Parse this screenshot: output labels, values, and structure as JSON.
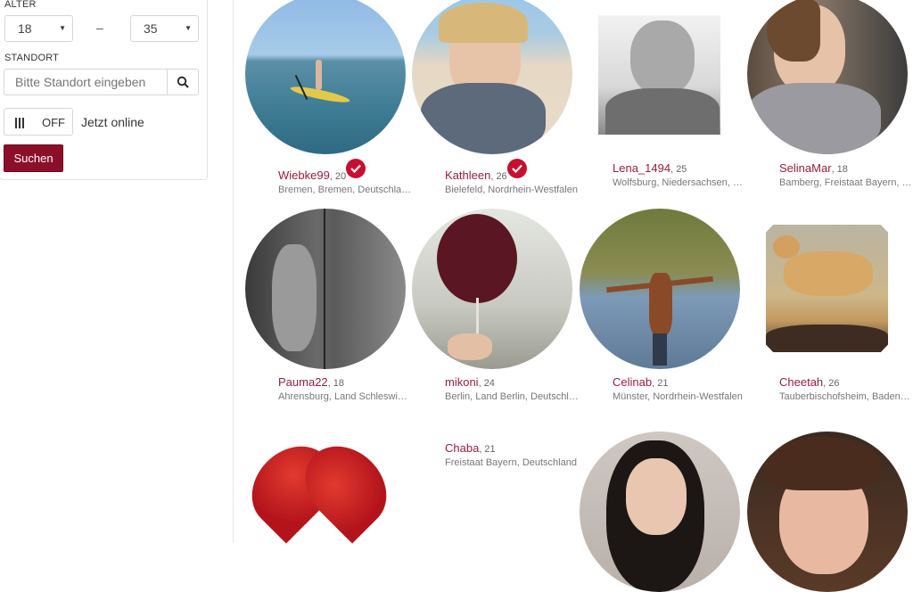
{
  "filters": {
    "age_label": "ALTER",
    "age_min": "18",
    "age_max": "35",
    "age_sep": "–",
    "location_label": "STANDORT",
    "location_placeholder": "Bitte Standort eingeben",
    "online_toggle": "OFF",
    "online_label": "Jetzt online",
    "search_button": "Suchen"
  },
  "profiles": [
    {
      "name": "Wiebke99",
      "age": ", 20",
      "location": "Bremen, Bremen, Deutschland",
      "verified": true
    },
    {
      "name": "Kathleen",
      "age": ", 26",
      "location": "Bielefeld, Nordrhein-Westfalen",
      "verified": true
    },
    {
      "name": "Lena_1494",
      "age": ", 25",
      "location": "Wolfsburg, Niedersachsen, Deutschland",
      "verified": false
    },
    {
      "name": "SelinaMar",
      "age": ", 18",
      "location": "Bamberg, Freistaat Bayern, Deutschland",
      "verified": false
    },
    {
      "name": "Pauma22",
      "age": ", 18",
      "location": "Ahrensburg, Land Schleswig-Holstein",
      "verified": false
    },
    {
      "name": "mikoni",
      "age": ", 24",
      "location": "Berlin, Land Berlin, Deutschland",
      "verified": false
    },
    {
      "name": "Celinab",
      "age": ", 21",
      "location": "Münster, Nordrhein-Westfalen",
      "verified": false
    },
    {
      "name": "Cheetah",
      "age": ", 26",
      "location": "Tauberbischofsheim, Baden-Württemberg",
      "verified": false
    },
    {
      "name": "Chaba",
      "age": ", 21",
      "location": "Freistaat Bayern, Deutschland",
      "verified": false
    }
  ],
  "colors": {
    "brand": "#8c0f2a",
    "name": "#9a1e3c",
    "verified": "#c8102e"
  }
}
